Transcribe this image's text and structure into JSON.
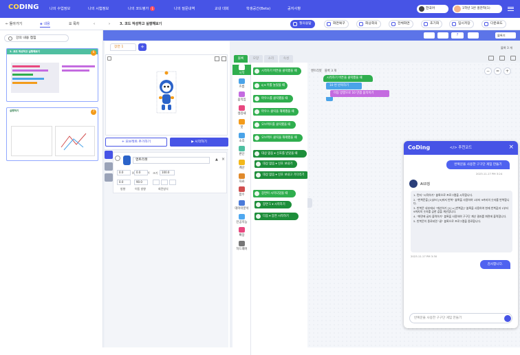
{
  "nav": {
    "logo_a": "CO",
    "logo_b": "DING",
    "items": [
      "나의 수업정보",
      "나의 시험정보",
      "나의 코드평가",
      "나의 질문내역",
      "교내 대회",
      "학생공간(Beta)",
      "공지사항"
    ],
    "badge": "1",
    "language": "한국어",
    "user": "1학년 1반 홍찬혁(1)"
  },
  "toolbar": {
    "back": "돌아가기",
    "content": "내용",
    "list": "목차",
    "lesson_title": "3. 코드 작성하고 실행해보기",
    "buttons": [
      "질의응답",
      "화면복구",
      "화상회의",
      "전체화면",
      "초기화",
      "임시저장",
      "다운로드"
    ]
  },
  "left": {
    "lesson_toggle": "강의 내용 접힘",
    "slides": [
      {
        "title": "3. 코드 작성하고 실행해보기",
        "num": "6"
      },
      {
        "title": "실행하기",
        "num": "7"
      }
    ]
  },
  "workspace": {
    "lang_select": "블록기",
    "block_count": "블록 3 개",
    "stage_tab": "장면 1",
    "add_object": "+ 오브젝트 추가하기",
    "run": "▶ 시작하기",
    "object_name": "엔트리봇",
    "fields": {
      "x": "0.0",
      "y": "0.0",
      "size": "100.0",
      "dir": "0.0",
      "move_dir": "90.0"
    },
    "labels": {
      "x": "X",
      "y": "Y",
      "size": "크기",
      "dir": "방향",
      "move_dir": "이동 방향",
      "rotate": "회전방식"
    },
    "palette_tabs": [
      "블록",
      "모양",
      "소리",
      "속성"
    ],
    "categories": [
      "시작",
      "흐름",
      "움직임",
      "생김새",
      "붓",
      "소리",
      "판단",
      "계산",
      "자료",
      "함수",
      "데이터분석",
      "인공지능",
      "확장",
      "하드웨어"
    ],
    "category_colors": [
      "#2fae4e",
      "#4aa3e8",
      "#c46be0",
      "#e8487f",
      "#f39b1a",
      "#4aa3e8",
      "#4fbfa0",
      "#f3b81a",
      "#e08a2c",
      "#d14f4f",
      "#4b7bd9",
      "#4fa8f0",
      "#e8487f",
      "#777777"
    ],
    "blocks": [
      "시작하기 버튼을 클릭했을 때",
      "q ▾ 키를 눌렀을 때",
      "마우스를 클릭했을 때",
      "마우스 클릭을 해제했을 때",
      "오브젝트를 클릭했을 때",
      "오브젝트 클릭을 해제했을 때",
      "대상 없음 ▾ 신호를 받았을 때",
      "대상 없음 ▾ 신호 보내기",
      "대상 없음 ▾ 신호 보내고 기다리기",
      "장면이 시작되었을 때",
      "장면 1 ▾ 시작하기",
      "다음 ▾ 장면 시작하기"
    ],
    "script": {
      "object": "엔트리봇",
      "count": "블록 3 개",
      "start": "시작하기 버튼을 클릭했을 때",
      "repeat": "10 번 반복하기",
      "move": "이동 방향으로 10 만큼 움직이기"
    }
  },
  "ai": {
    "title": "</> 추천코드",
    "logo": "CoDing",
    "user_q": "반복문을 사용한 구구단 게임 만들기",
    "ts1": "2023.11.17 PM 3:24",
    "coach": "AI코칭",
    "answer": [
      "1. 먼저 \"시작하기\" 블록으로 프로그램을 시작합니다.",
      "2. \"반복문을 [2]부터 [9]까지 반복\" 블록을 사용하여 1부터 9까지의 숫자를 반복합니다.",
      "3. 반복문 내부에서 \"계산하기 [1] x [반복값]\" 블록을 사용하여 현재 반복값과 1부터 9까지의 숫자를 곱한 값을 계산합니다.",
      "4. \"화면에 글자 출력하기\" 블록을 사용하여 구구단 계산 결과를 화면에 출력합니다.",
      "5. 반복문이 종료되면 \"끝\" 블록으로 프로그램을 종료합니다."
    ],
    "ts2": "2023.11.17 PM 3:30",
    "thanks": "감사합니다.",
    "input_placeholder": "반복문을 사용한 구구단 게임 만들기"
  }
}
